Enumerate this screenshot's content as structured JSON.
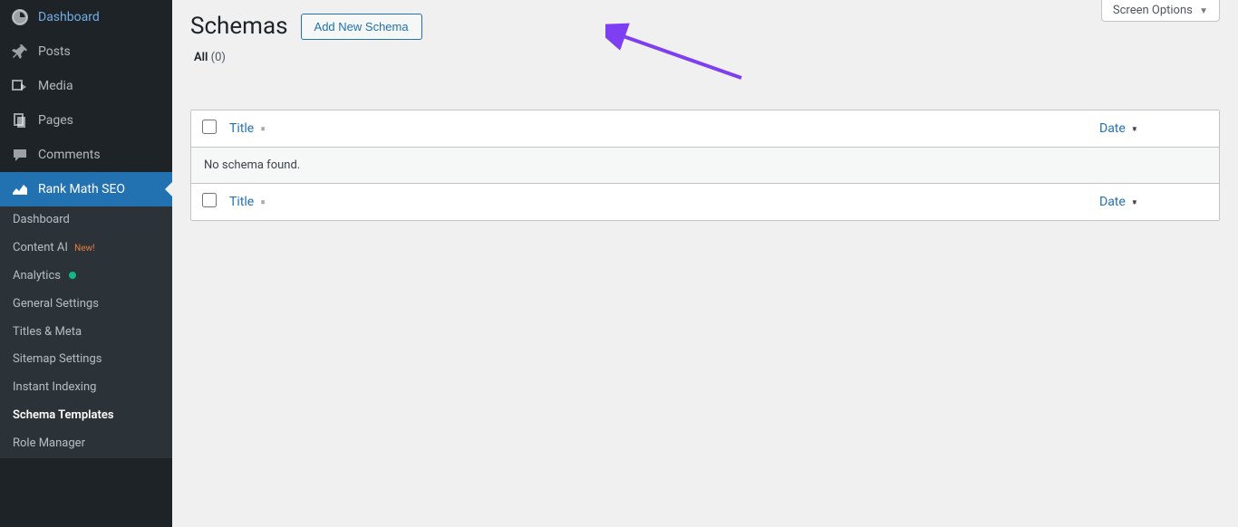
{
  "sidebar": {
    "items": [
      {
        "label": "Dashboard"
      },
      {
        "label": "Posts"
      },
      {
        "label": "Media"
      },
      {
        "label": "Pages"
      },
      {
        "label": "Comments"
      },
      {
        "label": "Rank Math SEO"
      }
    ]
  },
  "submenu": {
    "items": [
      {
        "label": "Dashboard"
      },
      {
        "label": "Content AI",
        "badge": "New!"
      },
      {
        "label": "Analytics",
        "dot": true
      },
      {
        "label": "General Settings"
      },
      {
        "label": "Titles & Meta"
      },
      {
        "label": "Sitemap Settings"
      },
      {
        "label": "Instant Indexing"
      },
      {
        "label": "Schema Templates"
      },
      {
        "label": "Role Manager"
      }
    ]
  },
  "header": {
    "screen_options": "Screen Options",
    "title": "Schemas",
    "add_button": "Add New Schema"
  },
  "subsub": {
    "all_label": "All",
    "count_text": "(0)"
  },
  "table": {
    "col_title": "Title",
    "col_date": "Date",
    "empty": "No schema found."
  }
}
